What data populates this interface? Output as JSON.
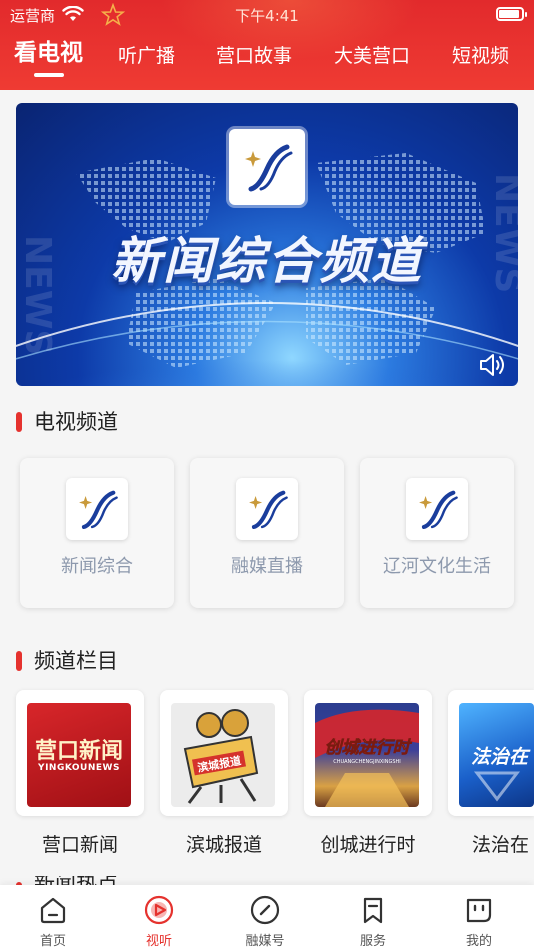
{
  "status_bar": {
    "carrier": "运营商",
    "time": "下午4:41"
  },
  "tabs": [
    {
      "label": "看电视",
      "active": true
    },
    {
      "label": "听广播",
      "active": false
    },
    {
      "label": "营口故事",
      "active": false
    },
    {
      "label": "大美营口",
      "active": false
    },
    {
      "label": "短视频",
      "active": false
    }
  ],
  "banner": {
    "title": "新闻综合频道",
    "watermark": "NEWS"
  },
  "tv_section": {
    "title": "电视频道",
    "channels": [
      {
        "label": "新闻综合"
      },
      {
        "label": "融媒直播"
      },
      {
        "label": "辽河文化生活"
      }
    ]
  },
  "program_section": {
    "title": "频道栏目",
    "programs": [
      {
        "label": "营口新闻",
        "thumb_text": "营口新闻",
        "thumb_subtext": "YINGKOUNEWS"
      },
      {
        "label": "滨城报道",
        "thumb_text": "滨城报道"
      },
      {
        "label": "创城进行时",
        "thumb_text": "创城进行时",
        "thumb_subtext": "CHUANGCHENGJINXINGSHI"
      },
      {
        "label": "法治在",
        "thumb_text": "法治在"
      }
    ]
  },
  "next_section": {
    "title": "新闻热点"
  },
  "bottom_nav": [
    {
      "label": "首页",
      "icon": "home-icon",
      "active": false
    },
    {
      "label": "视听",
      "icon": "play-icon",
      "active": true
    },
    {
      "label": "融媒号",
      "icon": "compass-icon",
      "active": false
    },
    {
      "label": "服务",
      "icon": "bookmark-icon",
      "active": false
    },
    {
      "label": "我的",
      "icon": "face-icon",
      "active": false
    }
  ],
  "colors": {
    "brand_red": "#e5322e",
    "header_red": "#e22a2c",
    "logo_blue": "#1a3d9c",
    "logo_gold": "#c99a3b"
  }
}
